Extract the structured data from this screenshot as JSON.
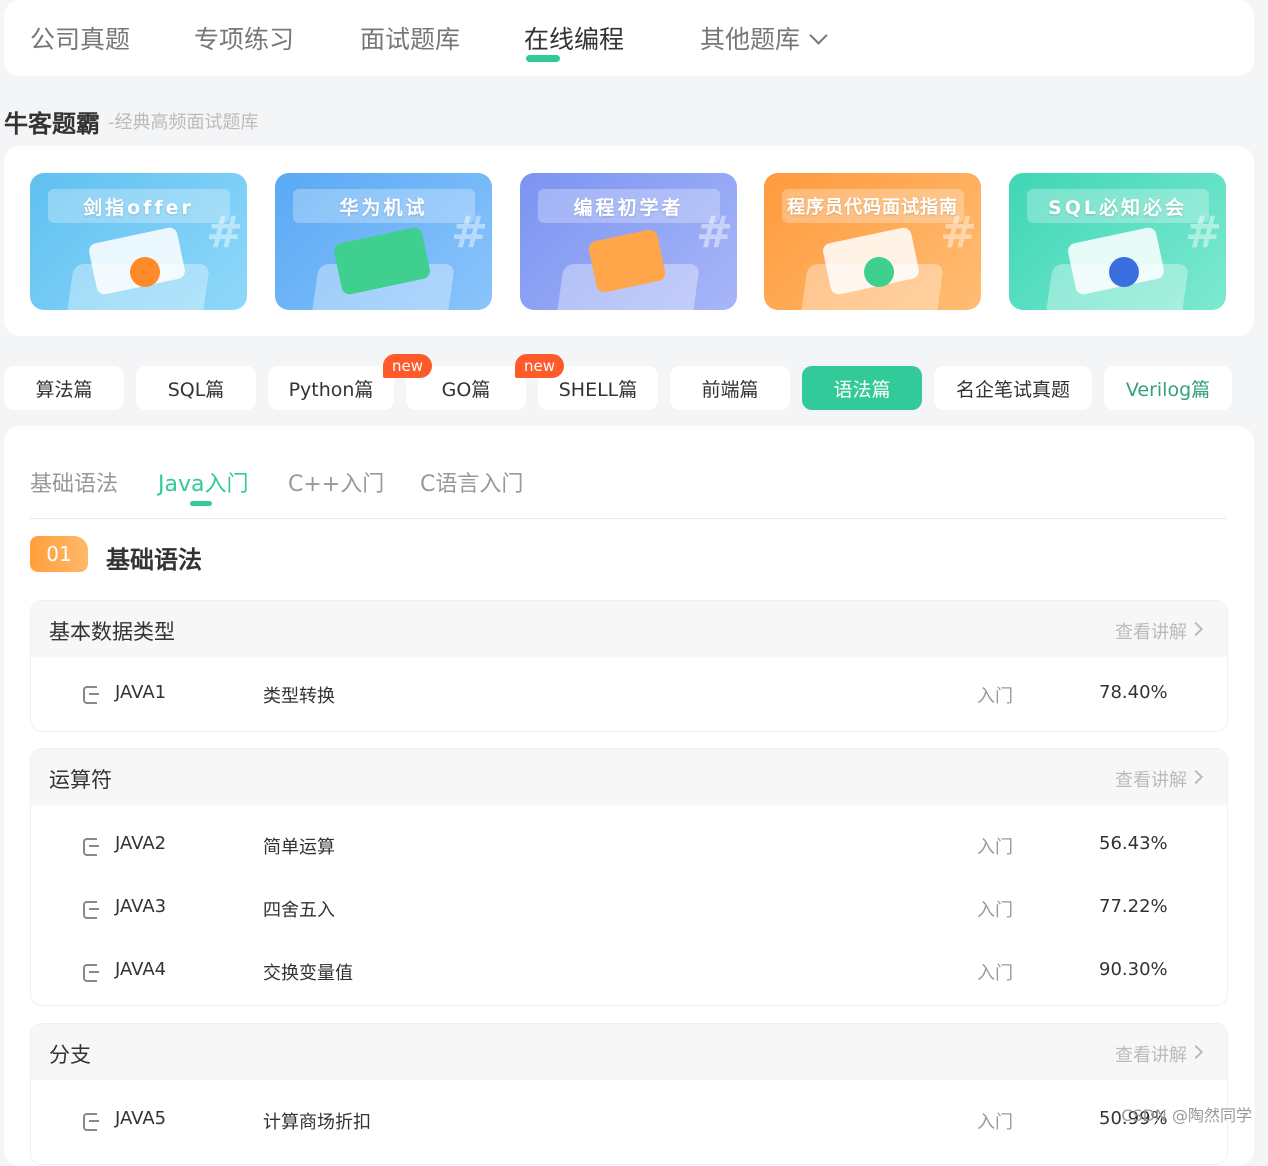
{
  "topnav": {
    "items": [
      {
        "label": "公司真题"
      },
      {
        "label": "专项练习"
      },
      {
        "label": "面试题库"
      },
      {
        "label": "在线编程"
      },
      {
        "label": "其他题库"
      }
    ]
  },
  "brand": {
    "title": "牛客题霸",
    "subtitle": "-经典高频面试题库"
  },
  "banners": [
    {
      "title": "剑指offer",
      "colors": [
        "#5fc0f0",
        "#8fd8fa"
      ]
    },
    {
      "title": "华为机试",
      "colors": [
        "#5aa9f5",
        "#8ac4fb"
      ]
    },
    {
      "title": "编程初学者",
      "colors": [
        "#7b94f2",
        "#a8b6f8"
      ]
    },
    {
      "title": "程序员代码面试指南",
      "colors": [
        "#ff9a3c",
        "#ffbd74"
      ]
    },
    {
      "title": "SQL必知必会",
      "colors": [
        "#3fd6b6",
        "#7de9d1"
      ]
    }
  ],
  "categories": [
    {
      "label": "算法篇"
    },
    {
      "label": "SQL篇"
    },
    {
      "label": "Python篇",
      "tag": "new"
    },
    {
      "label": "GO篇"
    },
    {
      "label": "SHELL篇",
      "tag": "new"
    },
    {
      "label": "前端篇"
    },
    {
      "label": "语法篇"
    },
    {
      "label": "名企笔试真题"
    },
    {
      "label": "Verilog篇"
    }
  ],
  "subtabs": [
    {
      "label": "基础语法"
    },
    {
      "label": "Java入门"
    },
    {
      "label": "C++入门"
    },
    {
      "label": "C语言入门"
    }
  ],
  "section": {
    "number": "01",
    "title": "基础语法"
  },
  "more_label": "查看讲解",
  "groups": [
    {
      "title": "基本数据类型",
      "rows": [
        {
          "id": "JAVA1",
          "name": "类型转换",
          "level": "入门",
          "rate": "78.40%"
        }
      ]
    },
    {
      "title": "运算符",
      "rows": [
        {
          "id": "JAVA2",
          "name": "简单运算",
          "level": "入门",
          "rate": "56.43%"
        },
        {
          "id": "JAVA3",
          "name": "四舍五入",
          "level": "入门",
          "rate": "77.22%"
        },
        {
          "id": "JAVA4",
          "name": "交换变量值",
          "level": "入门",
          "rate": "90.30%"
        }
      ]
    },
    {
      "title": "分支",
      "rows": [
        {
          "id": "JAVA5",
          "name": "计算商场折扣",
          "level": "入门",
          "rate": "50.99%"
        }
      ]
    }
  ],
  "watermark": "CSDN @陶然同学"
}
